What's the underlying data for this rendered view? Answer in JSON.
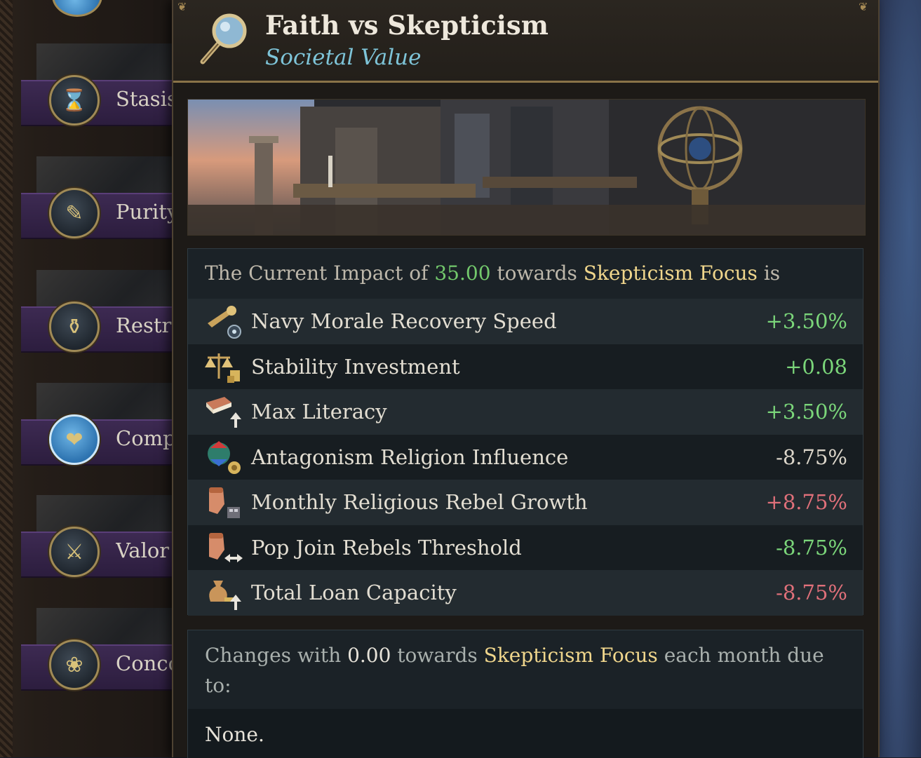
{
  "tooltip": {
    "title": "Faith vs Skepticism",
    "subtitle": "Societal Value",
    "impact": {
      "prefix": "The Current Impact of ",
      "amount": "35.00",
      "towards": " towards ",
      "focus": "Skepticism Focus",
      "suffix": " is"
    },
    "modifiers": [
      {
        "icon": "bugle-icon",
        "name": "Navy Morale Recovery Speed",
        "value": "+3.50%",
        "tone": "pos"
      },
      {
        "icon": "scales-icon",
        "name": "Stability Investment",
        "value": "+0.08",
        "tone": "pos"
      },
      {
        "icon": "book-icon",
        "name": "Max Literacy",
        "value": "+3.50%",
        "tone": "pos"
      },
      {
        "icon": "religion-icon",
        "name": "Antagonism Religion Influence",
        "value": "-8.75%",
        "tone": "neutral"
      },
      {
        "icon": "fist-icon",
        "name": "Monthly Religious Rebel Growth",
        "value": "+8.75%",
        "tone": "neg"
      },
      {
        "icon": "fist-arrows-icon",
        "name": "Pop Join Rebels Threshold",
        "value": "-8.75%",
        "tone": "pos"
      },
      {
        "icon": "money-bag-icon",
        "name": "Total Loan Capacity",
        "value": "-8.75%",
        "tone": "neg"
      }
    ],
    "changes": {
      "prefix": "Changes with ",
      "amount": "0.00",
      "towards": " towards ",
      "focus": "Skepticism Focus",
      "suffix": " each month due to:",
      "none": "None."
    }
  },
  "sidebar": {
    "items": [
      {
        "label": "Stasis",
        "icon": "hourglass-icon",
        "glyph": "⌛"
      },
      {
        "label": "Purity",
        "icon": "feather-icon",
        "glyph": "✎"
      },
      {
        "label": "Restraint",
        "icon": "urn-icon",
        "glyph": "⚱"
      },
      {
        "label": "Compassion",
        "icon": "hands-icon",
        "glyph": "❤",
        "selected": true
      },
      {
        "label": "Valor",
        "icon": "sword-icon",
        "glyph": "⚔"
      },
      {
        "label": "Concord",
        "icon": "laurel-icon",
        "glyph": "❀"
      }
    ]
  }
}
